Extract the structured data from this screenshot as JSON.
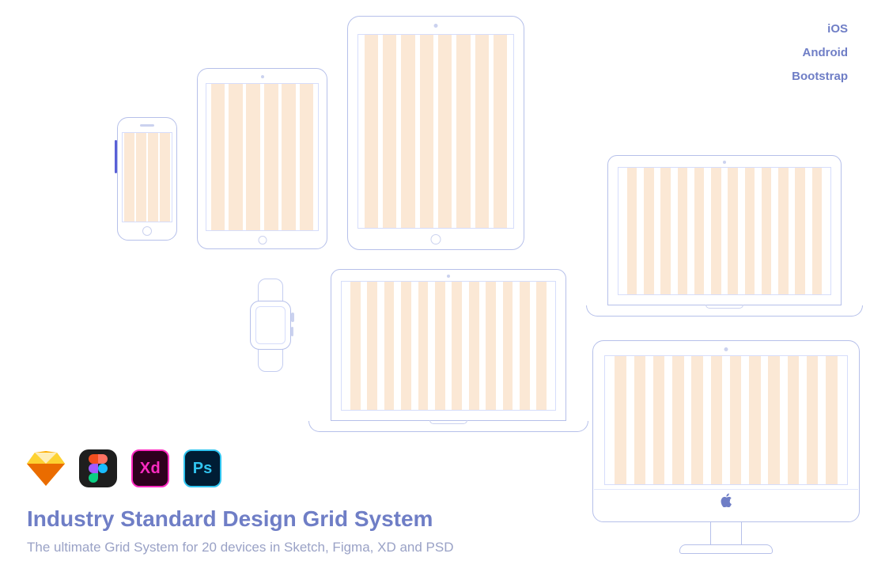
{
  "tags": [
    "iOS",
    "Android",
    "Bootstrap"
  ],
  "apps": {
    "sketch_label": "Sketch",
    "figma_label": "Figma",
    "xd_label": "Xd",
    "ps_label": "Ps"
  },
  "heading": "Industry Standard Design Grid System",
  "subhead": "The ultimate Grid System for 20 devices in Sketch, Figma, XD and PSD",
  "devices": {
    "phone": "iPhone",
    "ipad_small": "iPad",
    "ipad_large": "iPad Pro",
    "watch": "Apple Watch",
    "laptop1": "MacBook",
    "laptop2": "MacBook Pro",
    "imac": "iMac"
  },
  "colors": {
    "outline": "#b6c0ea",
    "accent": "#6f7ec6",
    "grid_column": "#fbe8d5"
  }
}
